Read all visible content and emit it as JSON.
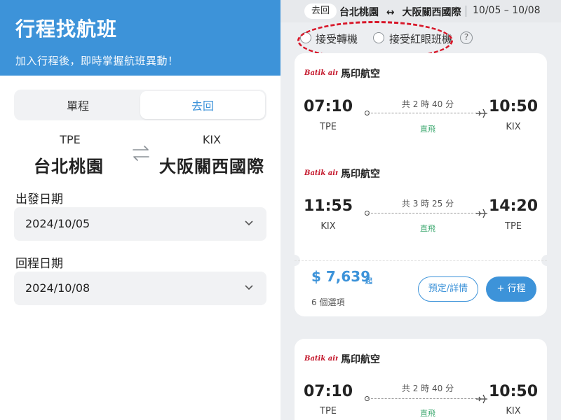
{
  "left_panel": {
    "title": "行程找航班",
    "subtitle": "加入行程後，即時掌握航班異動！",
    "trip_tabs": [
      "單程",
      "去回"
    ],
    "active_tab": "去回",
    "origin": {
      "code": "TPE",
      "city": "台北桃園"
    },
    "destination": {
      "code": "KIX",
      "city": "大阪關西國際"
    },
    "depart_label": "出發日期",
    "depart_value": "2024/10/05",
    "return_label": "回程日期",
    "return_value": "2024/10/08"
  },
  "right_panel": {
    "header": {
      "trip_tag": "去回",
      "route_from": "台北桃園",
      "route_arrow": "↔",
      "route_to": "大阪關西國際",
      "dates": "10/05 – 10/08"
    },
    "filters": {
      "transfer_label": "接受轉機",
      "redeye_label": "接受紅眼班機",
      "help": "?"
    },
    "results": [
      {
        "flights": [
          {
            "airline": "馬印航空",
            "logo_text": "Batik air",
            "dep_time": "07:10",
            "dep_code": "TPE",
            "arr_time": "10:50",
            "arr_code": "KIX",
            "duration": "共 2 時 40 分",
            "stops": "直飛"
          },
          {
            "airline": "馬印航空",
            "logo_text": "Batik air",
            "dep_time": "11:55",
            "dep_code": "KIX",
            "arr_time": "14:20",
            "arr_code": "TPE",
            "duration": "共 3 時 25 分",
            "stops": "直飛"
          }
        ],
        "price": "$ 7,639",
        "price_suffix": "起",
        "options": "6 個選項",
        "detail_button": "預定/詳情",
        "add_button": "+ 行程"
      },
      {
        "flights": [
          {
            "airline": "馬印航空",
            "logo_text": "Batik air",
            "dep_time": "07:10",
            "dep_code": "TPE",
            "arr_time": "10:50",
            "arr_code": "KIX",
            "duration": "共 2 時 40 分",
            "stops": "直飛"
          }
        ]
      }
    ]
  },
  "colors": {
    "brand_blue": "#3d93d9",
    "direct_green": "#3aa76d",
    "annotation_red": "#d8182a",
    "logo_red": "#c4172b"
  }
}
